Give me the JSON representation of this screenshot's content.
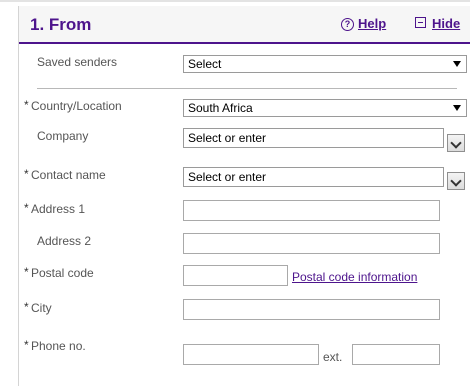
{
  "section": {
    "title": "1. From",
    "help_label": "Help",
    "help_icon": "question-circle-icon",
    "hide_label": "Hide",
    "hide_icon": "collapse-minus-icon"
  },
  "colors": {
    "accent": "#4d148c"
  },
  "fields": {
    "saved_senders": {
      "label": "Saved senders",
      "value": "Select"
    },
    "country": {
      "label": "Country/Location",
      "value": "South Africa",
      "required_mark": "*"
    },
    "company": {
      "label": "Company",
      "value": "Select or enter"
    },
    "contact": {
      "label": "Contact name",
      "value": "Select or enter",
      "required_mark": "*"
    },
    "address1": {
      "label": "Address 1",
      "value": "",
      "required_mark": "*"
    },
    "address2": {
      "label": "Address 2",
      "value": ""
    },
    "postal": {
      "label": "Postal code",
      "value": "",
      "required_mark": "*",
      "link": "Postal code information"
    },
    "city": {
      "label": "City",
      "value": "",
      "required_mark": "*"
    },
    "phone": {
      "label": "Phone no.",
      "value": "",
      "required_mark": "*",
      "ext_label": "ext.",
      "ext_value": ""
    }
  }
}
